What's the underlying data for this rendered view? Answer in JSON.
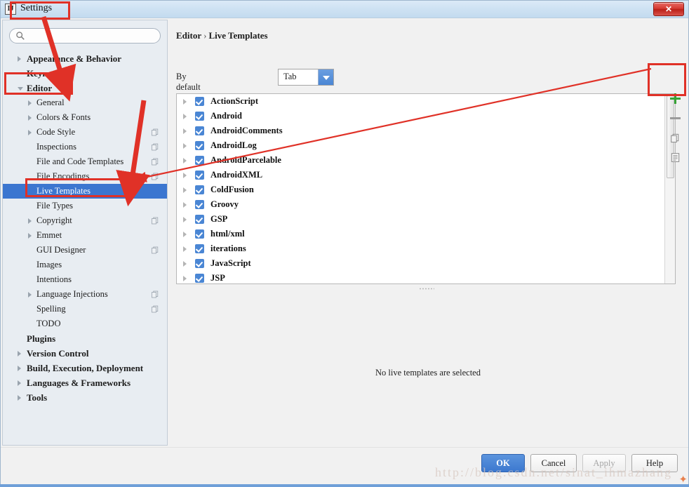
{
  "window": {
    "title": "Settings",
    "app_icon": "intellij-idea-icon",
    "close_label": "✕"
  },
  "sidebar": {
    "search": {
      "value": "",
      "placeholder": ""
    },
    "items": [
      {
        "label": "Appearance & Behavior",
        "level": 0,
        "arrow": "right",
        "bold": true,
        "selected": false,
        "copy_icon": false
      },
      {
        "label": "Keymap",
        "level": 0,
        "arrow": "none",
        "bold": true,
        "selected": false,
        "copy_icon": false
      },
      {
        "label": "Editor",
        "level": 0,
        "arrow": "down",
        "bold": true,
        "selected": false,
        "copy_icon": false
      },
      {
        "label": "General",
        "level": 1,
        "arrow": "right",
        "bold": false,
        "selected": false,
        "copy_icon": false
      },
      {
        "label": "Colors & Fonts",
        "level": 1,
        "arrow": "right",
        "bold": false,
        "selected": false,
        "copy_icon": false
      },
      {
        "label": "Code Style",
        "level": 1,
        "arrow": "right",
        "bold": false,
        "selected": false,
        "copy_icon": true
      },
      {
        "label": "Inspections",
        "level": 1,
        "arrow": "none",
        "bold": false,
        "selected": false,
        "copy_icon": true
      },
      {
        "label": "File and Code Templates",
        "level": 1,
        "arrow": "none",
        "bold": false,
        "selected": false,
        "copy_icon": true
      },
      {
        "label": "File Encodings",
        "level": 1,
        "arrow": "none",
        "bold": false,
        "selected": false,
        "copy_icon": true
      },
      {
        "label": "Live Templates",
        "level": 1,
        "arrow": "none",
        "bold": false,
        "selected": true,
        "copy_icon": false
      },
      {
        "label": "File Types",
        "level": 1,
        "arrow": "none",
        "bold": false,
        "selected": false,
        "copy_icon": false
      },
      {
        "label": "Copyright",
        "level": 1,
        "arrow": "right",
        "bold": false,
        "selected": false,
        "copy_icon": true
      },
      {
        "label": "Emmet",
        "level": 1,
        "arrow": "right",
        "bold": false,
        "selected": false,
        "copy_icon": false
      },
      {
        "label": "GUI Designer",
        "level": 1,
        "arrow": "none",
        "bold": false,
        "selected": false,
        "copy_icon": true
      },
      {
        "label": "Images",
        "level": 1,
        "arrow": "none",
        "bold": false,
        "selected": false,
        "copy_icon": false
      },
      {
        "label": "Intentions",
        "level": 1,
        "arrow": "none",
        "bold": false,
        "selected": false,
        "copy_icon": false
      },
      {
        "label": "Language Injections",
        "level": 1,
        "arrow": "right",
        "bold": false,
        "selected": false,
        "copy_icon": true
      },
      {
        "label": "Spelling",
        "level": 1,
        "arrow": "none",
        "bold": false,
        "selected": false,
        "copy_icon": true
      },
      {
        "label": "TODO",
        "level": 1,
        "arrow": "none",
        "bold": false,
        "selected": false,
        "copy_icon": false
      },
      {
        "label": "Plugins",
        "level": 0,
        "arrow": "none",
        "bold": true,
        "selected": false,
        "copy_icon": false
      },
      {
        "label": "Version Control",
        "level": 0,
        "arrow": "right",
        "bold": true,
        "selected": false,
        "copy_icon": false
      },
      {
        "label": "Build, Execution, Deployment",
        "level": 0,
        "arrow": "right",
        "bold": true,
        "selected": false,
        "copy_icon": false
      },
      {
        "label": "Languages & Frameworks",
        "level": 0,
        "arrow": "right",
        "bold": true,
        "selected": false,
        "copy_icon": false
      },
      {
        "label": "Tools",
        "level": 0,
        "arrow": "right",
        "bold": true,
        "selected": false,
        "copy_icon": false
      }
    ]
  },
  "main": {
    "breadcrumb": {
      "parent": "Editor",
      "separator": "›",
      "current": "Live Templates"
    },
    "expand_label": "By default expand with",
    "expand_value": "Tab",
    "templates": [
      {
        "name": "ActionScript",
        "checked": true
      },
      {
        "name": "Android",
        "checked": true
      },
      {
        "name": "AndroidComments",
        "checked": true
      },
      {
        "name": "AndroidLog",
        "checked": true
      },
      {
        "name": "AndroidParcelable",
        "checked": true
      },
      {
        "name": "AndroidXML",
        "checked": true
      },
      {
        "name": "ColdFusion",
        "checked": true
      },
      {
        "name": "Groovy",
        "checked": true
      },
      {
        "name": "GSP",
        "checked": true
      },
      {
        "name": "html/xml",
        "checked": true
      },
      {
        "name": "iterations",
        "checked": true
      },
      {
        "name": "JavaScript",
        "checked": true
      },
      {
        "name": "JSP",
        "checked": true
      }
    ],
    "empty_message": "No live templates are selected",
    "toolbar": [
      {
        "icon": "plus-icon",
        "name": "add-template-button"
      },
      {
        "icon": "minus-icon",
        "name": "remove-template-button"
      },
      {
        "icon": "copy-icon",
        "name": "duplicate-template-button"
      },
      {
        "icon": "list-icon",
        "name": "template-group-button"
      }
    ]
  },
  "footer": {
    "ok": "OK",
    "cancel": "Cancel",
    "apply": "Apply",
    "help": "Help"
  },
  "watermark": {
    "text": "http://blog.csdn.net/sinat_ihmazhang"
  },
  "colors": {
    "accent": "#3b76d0",
    "checkbox": "#4a86d4",
    "annotation": "#e03127",
    "plus": "#36a336",
    "close": "#d53a32"
  }
}
